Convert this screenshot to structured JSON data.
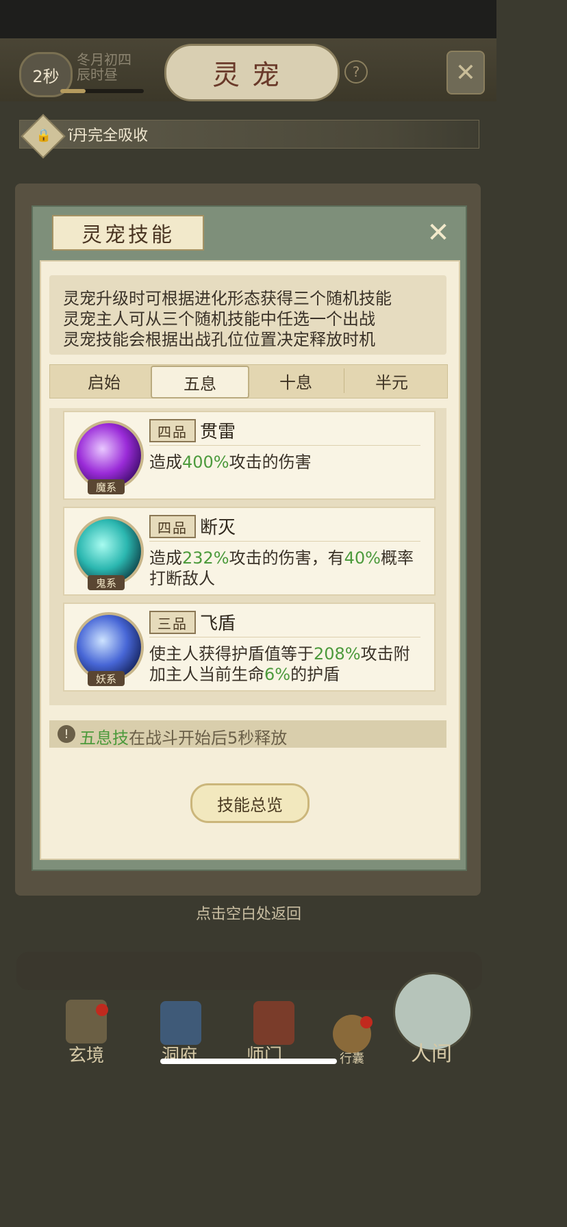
{
  "header": {
    "timer": "2秒",
    "date_line1": "冬月初四",
    "date_line2": "辰时昼",
    "title": "灵宠",
    "help": "?",
    "close": "✕"
  },
  "notice": {
    "icon": "lock-icon",
    "text": "ĩ丹完全吸收"
  },
  "modal": {
    "title": "灵宠技能",
    "close": "✕",
    "description": [
      "灵宠升级时可根据进化形态获得三个随机技能",
      "灵宠主人可从三个随机技能中任选一个出战",
      "灵宠技能会根据出战孔位位置决定释放时机"
    ],
    "tabs": [
      {
        "label": "启始",
        "active": false
      },
      {
        "label": "五息",
        "active": true
      },
      {
        "label": "十息",
        "active": false
      },
      {
        "label": "半元",
        "active": false
      }
    ],
    "skills": [
      {
        "element": "魔系",
        "grade": "四品",
        "name": "贯雷",
        "effect_line1": {
          "pre": "造成",
          "hl": "400%",
          "post": "攻击的伤害"
        }
      },
      {
        "element": "鬼系",
        "grade": "四品",
        "name": "断灭",
        "effect_line1": {
          "pre": "造成",
          "hl": "232%",
          "mid": "攻击的伤害，有",
          "hl2": "40%",
          "post": "概率"
        },
        "effect_line2": "打断敌人"
      },
      {
        "element": "妖系",
        "grade": "三品",
        "name": "飞盾",
        "effect_line1": {
          "pre": "使主人获得护盾值等于",
          "hl": "208%",
          "post": "攻击附"
        },
        "effect_line2": {
          "pre": "加主人当前生命",
          "hl": "6%",
          "post": "的护盾"
        }
      }
    ],
    "tip": {
      "hl": "五息技",
      "text": "在战斗开始后5秒释放"
    },
    "overview_button": "技能总览"
  },
  "return_tip": "点击空白处返回",
  "bottom_nav": [
    {
      "label": "玄境"
    },
    {
      "label": "洞府"
    },
    {
      "label": "师门"
    },
    {
      "label": "行囊"
    },
    {
      "label": "人间"
    }
  ],
  "colors": {
    "accent_green": "#4c9a3c",
    "panel": "#f5eed9",
    "modal_frame": "#7e8f7a"
  }
}
